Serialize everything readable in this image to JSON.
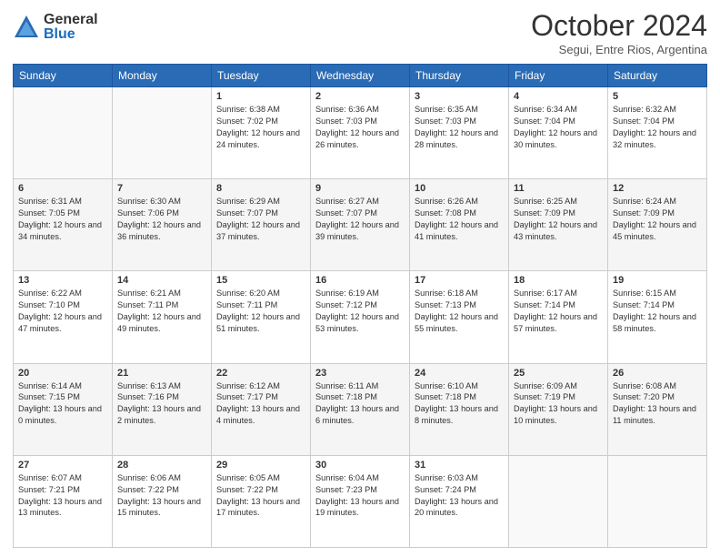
{
  "logo": {
    "general": "General",
    "blue": "Blue"
  },
  "title": "October 2024",
  "subtitle": "Segui, Entre Rios, Argentina",
  "days": [
    "Sunday",
    "Monday",
    "Tuesday",
    "Wednesday",
    "Thursday",
    "Friday",
    "Saturday"
  ],
  "weeks": [
    [
      {
        "day": "",
        "content": ""
      },
      {
        "day": "",
        "content": ""
      },
      {
        "day": "1",
        "content": "Sunrise: 6:38 AM\nSunset: 7:02 PM\nDaylight: 12 hours and 24 minutes."
      },
      {
        "day": "2",
        "content": "Sunrise: 6:36 AM\nSunset: 7:03 PM\nDaylight: 12 hours and 26 minutes."
      },
      {
        "day": "3",
        "content": "Sunrise: 6:35 AM\nSunset: 7:03 PM\nDaylight: 12 hours and 28 minutes."
      },
      {
        "day": "4",
        "content": "Sunrise: 6:34 AM\nSunset: 7:04 PM\nDaylight: 12 hours and 30 minutes."
      },
      {
        "day": "5",
        "content": "Sunrise: 6:32 AM\nSunset: 7:04 PM\nDaylight: 12 hours and 32 minutes."
      }
    ],
    [
      {
        "day": "6",
        "content": "Sunrise: 6:31 AM\nSunset: 7:05 PM\nDaylight: 12 hours and 34 minutes."
      },
      {
        "day": "7",
        "content": "Sunrise: 6:30 AM\nSunset: 7:06 PM\nDaylight: 12 hours and 36 minutes."
      },
      {
        "day": "8",
        "content": "Sunrise: 6:29 AM\nSunset: 7:07 PM\nDaylight: 12 hours and 37 minutes."
      },
      {
        "day": "9",
        "content": "Sunrise: 6:27 AM\nSunset: 7:07 PM\nDaylight: 12 hours and 39 minutes."
      },
      {
        "day": "10",
        "content": "Sunrise: 6:26 AM\nSunset: 7:08 PM\nDaylight: 12 hours and 41 minutes."
      },
      {
        "day": "11",
        "content": "Sunrise: 6:25 AM\nSunset: 7:09 PM\nDaylight: 12 hours and 43 minutes."
      },
      {
        "day": "12",
        "content": "Sunrise: 6:24 AM\nSunset: 7:09 PM\nDaylight: 12 hours and 45 minutes."
      }
    ],
    [
      {
        "day": "13",
        "content": "Sunrise: 6:22 AM\nSunset: 7:10 PM\nDaylight: 12 hours and 47 minutes."
      },
      {
        "day": "14",
        "content": "Sunrise: 6:21 AM\nSunset: 7:11 PM\nDaylight: 12 hours and 49 minutes."
      },
      {
        "day": "15",
        "content": "Sunrise: 6:20 AM\nSunset: 7:11 PM\nDaylight: 12 hours and 51 minutes."
      },
      {
        "day": "16",
        "content": "Sunrise: 6:19 AM\nSunset: 7:12 PM\nDaylight: 12 hours and 53 minutes."
      },
      {
        "day": "17",
        "content": "Sunrise: 6:18 AM\nSunset: 7:13 PM\nDaylight: 12 hours and 55 minutes."
      },
      {
        "day": "18",
        "content": "Sunrise: 6:17 AM\nSunset: 7:14 PM\nDaylight: 12 hours and 57 minutes."
      },
      {
        "day": "19",
        "content": "Sunrise: 6:15 AM\nSunset: 7:14 PM\nDaylight: 12 hours and 58 minutes."
      }
    ],
    [
      {
        "day": "20",
        "content": "Sunrise: 6:14 AM\nSunset: 7:15 PM\nDaylight: 13 hours and 0 minutes."
      },
      {
        "day": "21",
        "content": "Sunrise: 6:13 AM\nSunset: 7:16 PM\nDaylight: 13 hours and 2 minutes."
      },
      {
        "day": "22",
        "content": "Sunrise: 6:12 AM\nSunset: 7:17 PM\nDaylight: 13 hours and 4 minutes."
      },
      {
        "day": "23",
        "content": "Sunrise: 6:11 AM\nSunset: 7:18 PM\nDaylight: 13 hours and 6 minutes."
      },
      {
        "day": "24",
        "content": "Sunrise: 6:10 AM\nSunset: 7:18 PM\nDaylight: 13 hours and 8 minutes."
      },
      {
        "day": "25",
        "content": "Sunrise: 6:09 AM\nSunset: 7:19 PM\nDaylight: 13 hours and 10 minutes."
      },
      {
        "day": "26",
        "content": "Sunrise: 6:08 AM\nSunset: 7:20 PM\nDaylight: 13 hours and 11 minutes."
      }
    ],
    [
      {
        "day": "27",
        "content": "Sunrise: 6:07 AM\nSunset: 7:21 PM\nDaylight: 13 hours and 13 minutes."
      },
      {
        "day": "28",
        "content": "Sunrise: 6:06 AM\nSunset: 7:22 PM\nDaylight: 13 hours and 15 minutes."
      },
      {
        "day": "29",
        "content": "Sunrise: 6:05 AM\nSunset: 7:22 PM\nDaylight: 13 hours and 17 minutes."
      },
      {
        "day": "30",
        "content": "Sunrise: 6:04 AM\nSunset: 7:23 PM\nDaylight: 13 hours and 19 minutes."
      },
      {
        "day": "31",
        "content": "Sunrise: 6:03 AM\nSunset: 7:24 PM\nDaylight: 13 hours and 20 minutes."
      },
      {
        "day": "",
        "content": ""
      },
      {
        "day": "",
        "content": ""
      }
    ]
  ]
}
